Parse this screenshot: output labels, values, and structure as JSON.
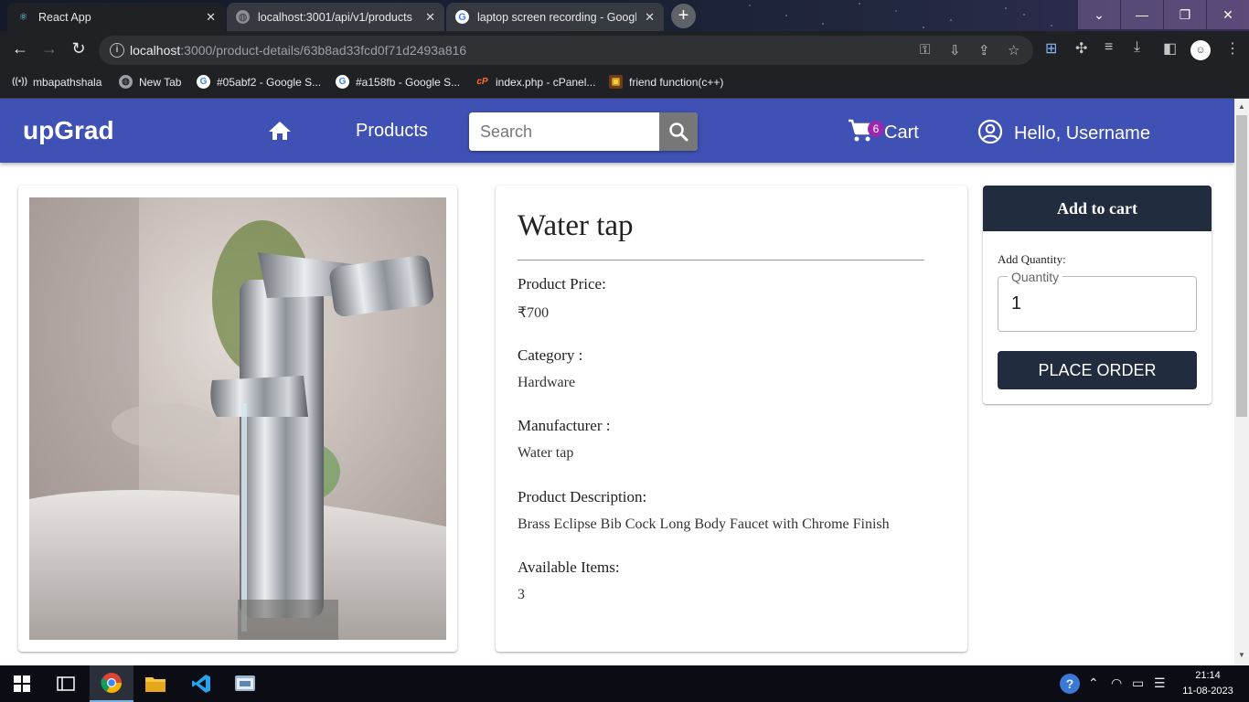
{
  "browser": {
    "tabs": [
      {
        "title": "React App",
        "active": true,
        "favicon": "react-icon"
      },
      {
        "title": "localhost:3001/api/v1/products",
        "active": false,
        "favicon": "globe-icon"
      },
      {
        "title": "laptop screen recording - Google",
        "active": false,
        "favicon": "google-icon"
      }
    ],
    "url_host": "localhost",
    "url_path": ":3000/product-details/63b8ad33fcd0f71d2493a816",
    "bookmarks": [
      {
        "label": "mbapathshala",
        "icon": "radio-icon"
      },
      {
        "label": "New Tab",
        "icon": "globe-icon"
      },
      {
        "label": "#05abf2 - Google S...",
        "icon": "google-icon"
      },
      {
        "label": "#a158fb - Google S...",
        "icon": "google-icon"
      },
      {
        "label": "index.php - cPanel...",
        "icon": "cpanel-icon"
      },
      {
        "label": "friend function(c++)",
        "icon": "bookmark-icon"
      }
    ]
  },
  "app": {
    "brand": "upGrad",
    "nav_products": "Products",
    "search_placeholder": "Search",
    "cart_count": "6",
    "cart_label": "Cart",
    "user_label": "Hello, Username",
    "accent_color": "#3f51b5",
    "dark_button_color": "#212c3f"
  },
  "product": {
    "title": "Water tap",
    "price_label": "Product Price:",
    "price": "₹700",
    "category_label": "Category :",
    "category": "Hardware",
    "manufacturer_label": "Manufacturer :",
    "manufacturer": "Water tap",
    "description_label": "Product Description:",
    "description": "Brass Eclipse Bib Cock Long Body Faucet with Chrome Finish",
    "available_label": "Available Items:",
    "available": "3"
  },
  "order": {
    "add_to_cart": "Add to cart",
    "add_quantity_label": "Add Quantity:",
    "quantity_legend": "Quantity",
    "quantity_value": "1",
    "place_order": "PLACE ORDER"
  },
  "taskbar": {
    "time": "21:14",
    "date": "11-08-2023"
  }
}
